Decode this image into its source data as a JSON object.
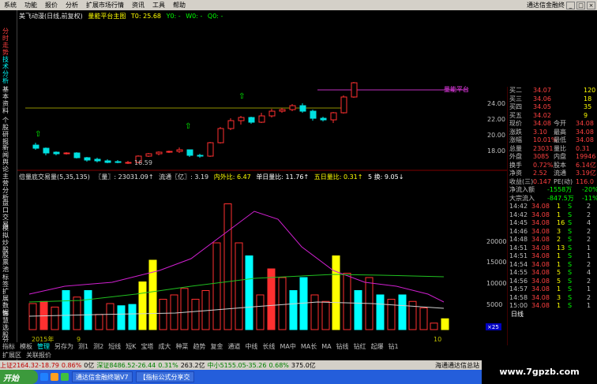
{
  "menu": {
    "items": [
      "系统",
      "功能",
      "报价",
      "分析",
      "扩展市场行情",
      "资讯",
      "工具",
      "帮助"
    ],
    "app_title": "通达信金融终"
  },
  "left_toolbar": [
    "分时走势",
    "技术分析",
    "基本资料",
    "个股研报",
    "新闻舆论",
    "主营分析",
    "盘口交易",
    "模拟炒股",
    "股票池",
    "标签",
    "扩展数据",
    "智慧选股",
    "分时",
    "新闻"
  ],
  "header": {
    "title": "美飞动漫(日线,前复权)",
    "indicator": "量能平台主图",
    "t0": "T0: 25.68",
    "y0": "Y0: -",
    "w0": "W0: -",
    "q0": "Q0: -",
    "price_label_right": "量能平台"
  },
  "kline": {
    "low_label": "16.59",
    "price_ticks": [
      "24.00",
      "22.00",
      "20.00",
      "18.00"
    ]
  },
  "volume_info": {
    "title": "倍量底交易量(5,35,135)",
    "vol": "〖量〗: 23031.09↑",
    "float": "流通〖亿〗: 3.19",
    "inout_label": "内外比: 6.47",
    "dan_label": "单日量比: 11.76↑",
    "wu_label": "五日量比: 0.31↑",
    "wu_huan": "5 换: 9.05↓",
    "vol_ticks": [
      "20000",
      "15000",
      "10000",
      "5000"
    ],
    "year_label": "2015年",
    "month_label": "9",
    "month2": "10",
    "scale": "×25"
  },
  "quotes": {
    "sells": [
      {
        "label": "买二",
        "price": "34.07",
        "vol": "120"
      },
      {
        "label": "买三",
        "price": "34.06",
        "vol": "18"
      },
      {
        "label": "买四",
        "price": "34.05",
        "vol": "35"
      },
      {
        "label": "买五",
        "price": "34.02",
        "vol": "9"
      }
    ],
    "stats": [
      {
        "l1": "现价",
        "v1": "34.08",
        "l2": "今开",
        "v2": "34.08"
      },
      {
        "l1": "涨跌",
        "v1": "3.10",
        "l2": "最高",
        "v2": "34.08"
      },
      {
        "l1": "涨幅",
        "v1": "10.01%",
        "l2": "最低",
        "v2": "34.08"
      },
      {
        "l1": "总量",
        "v1": "23031",
        "l2": "量比",
        "v2": "0.31"
      },
      {
        "l1": "外盘",
        "v1": "3085",
        "l2": "内盘",
        "v2": "19946"
      },
      {
        "l1": "换手",
        "v1": "0.72%",
        "l2": "股本",
        "v2": "6.14亿"
      },
      {
        "l1": "净资",
        "v1": "2.52",
        "l2": "流通",
        "v2": "3.19亿"
      },
      {
        "l1": "收益(三)",
        "v1": "0.147",
        "l2": "PE(动)",
        "v2": "116.0"
      }
    ],
    "flow": [
      {
        "l": "净流入额",
        "v1": "-1558万",
        "v2": "-20%"
      },
      {
        "l": "大宗流入",
        "v1": "-847.5万",
        "v2": "-11%"
      }
    ],
    "ticks": [
      {
        "t": "14:42",
        "p": "34.08",
        "v": "1",
        "s": "S",
        "n": "2"
      },
      {
        "t": "14:42",
        "p": "34.08",
        "v": "1",
        "s": "S",
        "n": "2"
      },
      {
        "t": "14:45",
        "p": "34.08",
        "v": "16",
        "s": "S",
        "n": "4"
      },
      {
        "t": "14:46",
        "p": "34.08",
        "v": "3",
        "s": "S",
        "n": "2"
      },
      {
        "t": "14:48",
        "p": "34.08",
        "v": "2",
        "s": "S",
        "n": "2"
      },
      {
        "t": "14:51",
        "p": "34.08",
        "v": "13",
        "s": "S",
        "n": "1"
      },
      {
        "t": "14:51",
        "p": "34.08",
        "v": "1",
        "s": "S",
        "n": "1"
      },
      {
        "t": "14:54",
        "p": "34.08",
        "v": "1",
        "s": "S",
        "n": "2"
      },
      {
        "t": "14:55",
        "p": "34.08",
        "v": "5",
        "s": "S",
        "n": "4"
      },
      {
        "t": "14:56",
        "p": "34.08",
        "v": "5",
        "s": "S",
        "n": "2"
      },
      {
        "t": "14:57",
        "p": "34.08",
        "v": "1",
        "s": "S",
        "n": "1"
      },
      {
        "t": "14:58",
        "p": "34.08",
        "v": "3",
        "s": "S",
        "n": "2"
      },
      {
        "t": "15:00",
        "p": "34.08",
        "v": "1",
        "s": "S",
        "n": "1"
      }
    ],
    "minute_label": "日线"
  },
  "tabs": [
    "指标",
    "模板",
    "管理",
    "另存为",
    "测1",
    "测2",
    "短线",
    "短K",
    "宝塔",
    "成大",
    "种菜",
    "趋势",
    "复金",
    "通道",
    "中线",
    "长线",
    "MA中",
    "MA长",
    "MA",
    "钻线",
    "钻红",
    "起爆",
    "钻1"
  ],
  "tabs2": [
    "扩展区",
    "关联报价"
  ],
  "status": {
    "sh": "上证2164.32-18.79",
    "sh_amt": "0.86%",
    "sh_vol": "0亿",
    "sz": "深证8486.52-26.44",
    "sz_pct": "0.31%",
    "sz_vol": "263.2亿",
    "zx": "中小5155.05-35.26",
    "zx_pct": "0.68%",
    "zx_vol": "375.0亿",
    "right": "海通通达信总站"
  },
  "taskbar": {
    "start": "开始",
    "task1": "通达信金融终端V7",
    "task2": "【指标公式分享交"
  },
  "watermark": "www.7gpzb.com"
}
